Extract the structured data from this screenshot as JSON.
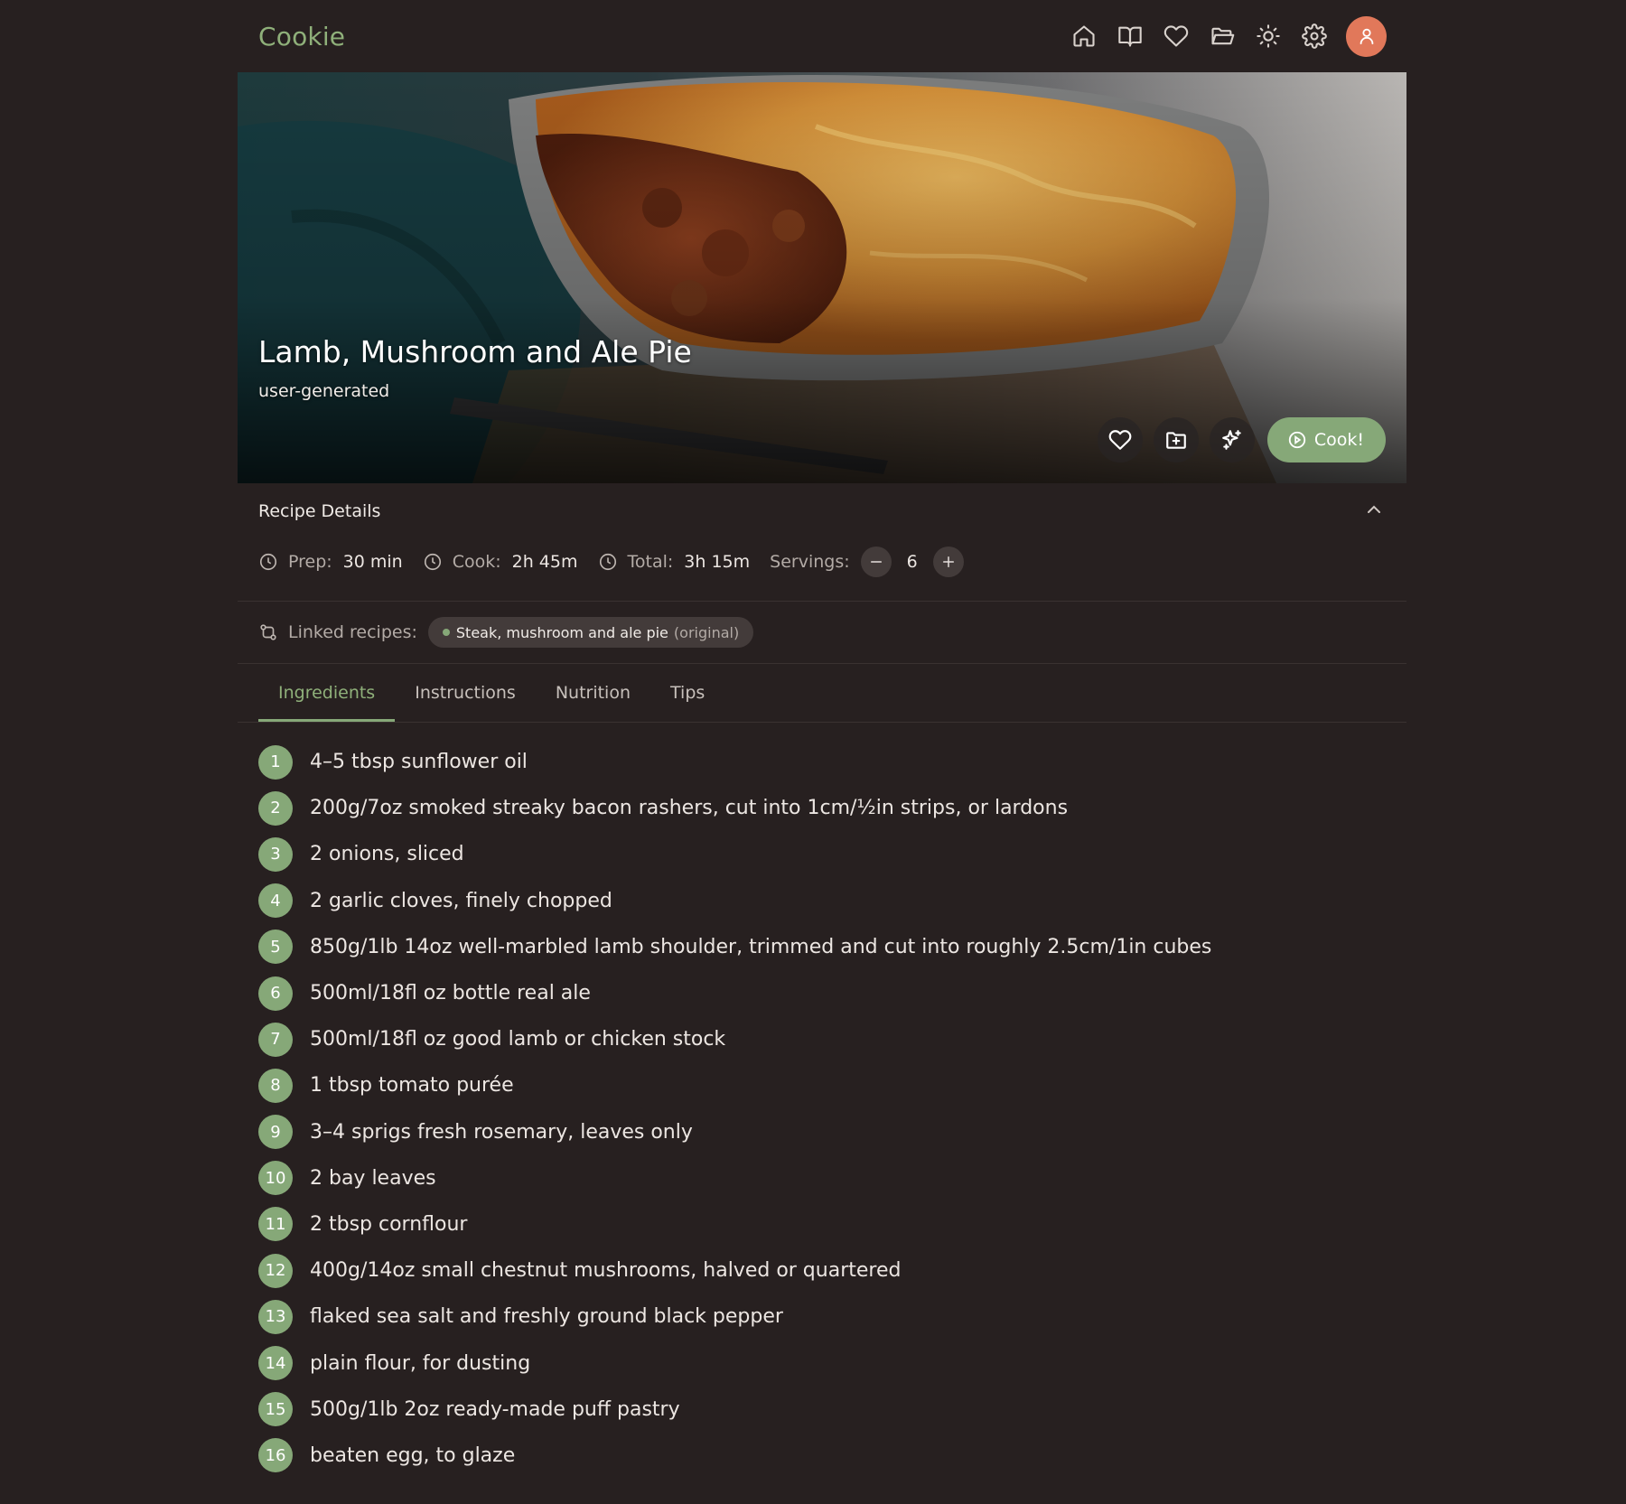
{
  "app": {
    "brand": "Cookie"
  },
  "nav": {
    "icons": [
      "home-icon",
      "book-icon",
      "heart-icon",
      "folder-icon",
      "sun-icon",
      "gear-icon",
      "user-icon"
    ]
  },
  "recipe": {
    "title": "Lamb, Mushroom and Ale Pie",
    "source": "user-generated",
    "cook_label": "Cook!"
  },
  "details": {
    "title": "Recipe Details",
    "prep_label": "Prep:",
    "prep_value": "30 min",
    "cook_label": "Cook:",
    "cook_value": "2h 45m",
    "total_label": "Total:",
    "total_value": "3h 15m",
    "servings_label": "Servings:",
    "servings_value": "6",
    "linked_label": "Linked recipes:",
    "linked_name": "Steak, mushroom and ale pie",
    "linked_tag": "(original)"
  },
  "tabs": [
    "Ingredients",
    "Instructions",
    "Nutrition",
    "Tips"
  ],
  "active_tab": "Ingredients",
  "ingredients": [
    {
      "n": "1",
      "text": "4–5 tbsp sunflower oil"
    },
    {
      "n": "2",
      "text": "200g/7oz smoked streaky bacon rashers, cut into 1cm/½in strips, or lardons"
    },
    {
      "n": "3",
      "text": "2 onions, sliced"
    },
    {
      "n": "4",
      "text": "2 garlic cloves, finely chopped"
    },
    {
      "n": "5",
      "text": "850g/1lb 14oz well-marbled lamb shoulder, trimmed and cut into roughly 2.5cm/1in cubes"
    },
    {
      "n": "6",
      "text": "500ml/18fl oz bottle real ale"
    },
    {
      "n": "7",
      "text": "500ml/18fl oz good lamb or chicken stock"
    },
    {
      "n": "8",
      "text": "1 tbsp tomato purée"
    },
    {
      "n": "9",
      "text": "3–4 sprigs fresh rosemary, leaves only"
    },
    {
      "n": "10",
      "text": "2 bay leaves"
    },
    {
      "n": "11",
      "text": "2 tbsp cornflour"
    },
    {
      "n": "12",
      "text": "400g/14oz small chestnut mushrooms, halved or quartered"
    },
    {
      "n": "13",
      "text": "flaked sea salt and freshly ground black pepper"
    },
    {
      "n": "14",
      "text": "plain flour, for dusting"
    },
    {
      "n": "15",
      "text": "500g/1lb 2oz ready-made puff pastry"
    },
    {
      "n": "16",
      "text": "beaten egg, to glaze"
    }
  ],
  "colors": {
    "background": "#272020",
    "accent": "#86a878",
    "avatar": "#e1785a"
  }
}
